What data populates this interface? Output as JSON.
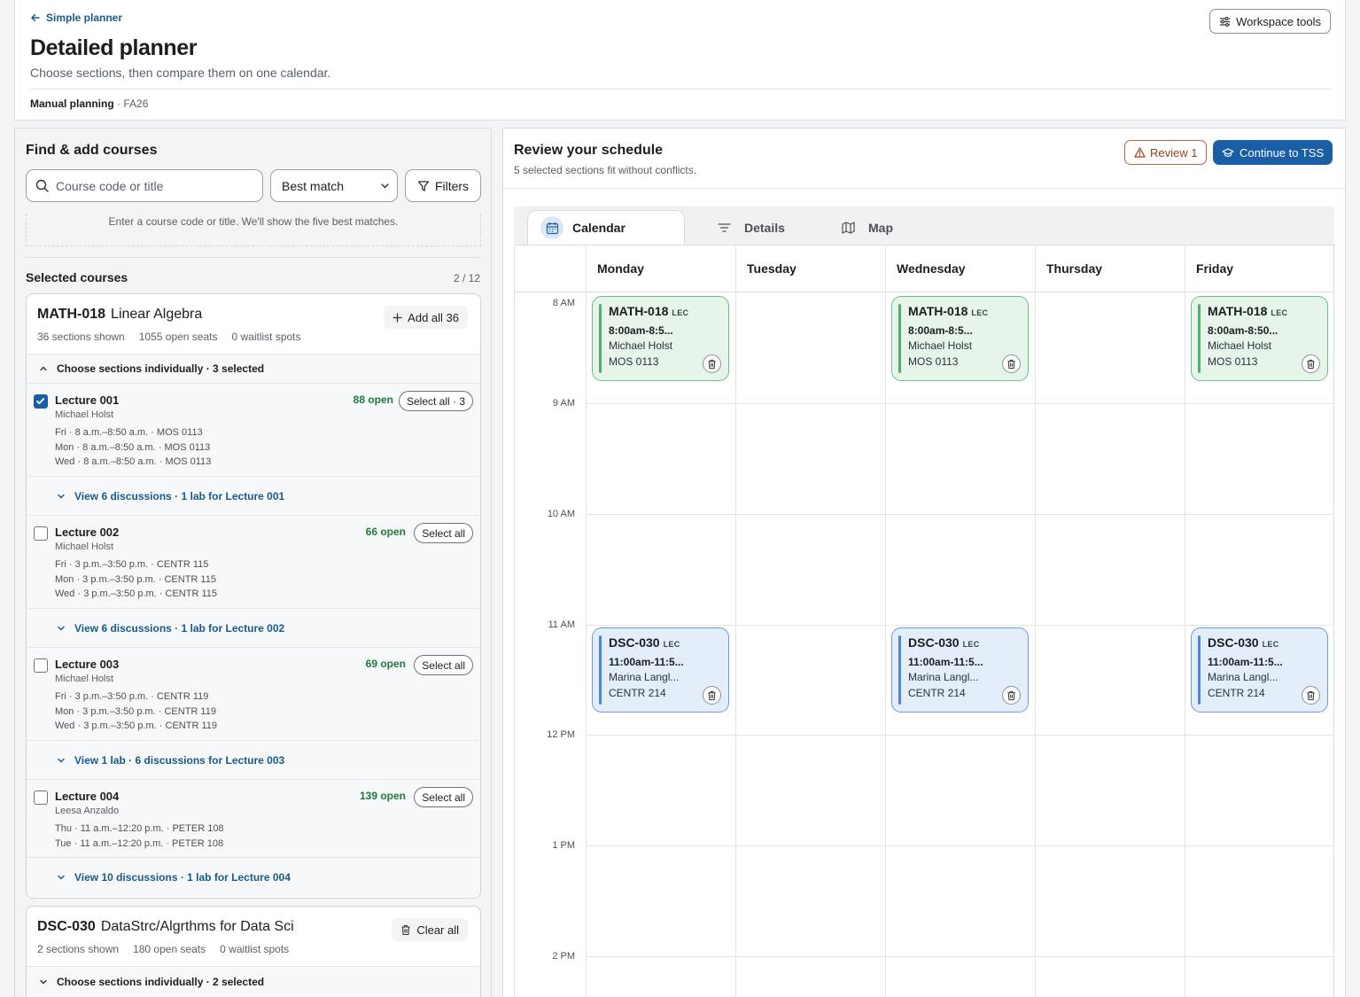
{
  "header": {
    "back_label": "Simple planner",
    "title": "Detailed planner",
    "subtitle": "Choose sections, then compare them on one calendar.",
    "plan_mode": "Manual planning",
    "term": "· FA26",
    "workspace_tools": "Workspace tools"
  },
  "finder": {
    "title": "Find & add courses",
    "search_placeholder": "Course code or title",
    "sort_value": "Best match",
    "filters_label": "Filters",
    "hint": "Enter a course code or title. We'll show the five best matches."
  },
  "selected": {
    "title": "Selected courses",
    "count": "2 / 12",
    "courses": [
      {
        "code": "MATH-018",
        "name": "Linear Algebra",
        "sections_shown": "36 sections shown",
        "open_seats": "1055 open seats",
        "waitlist": "0 waitlist spots",
        "action": "Add all 36",
        "toggle": "Choose sections individually · 3 selected",
        "lectures": [
          {
            "title": "Lecture 001",
            "prof": "Michael Holst",
            "open": "88 open",
            "select": "Select all · 3",
            "checked": true,
            "times": [
              "Fri · 8 a.m.–8:50 a.m. · MOS 0113",
              "Mon · 8 a.m.–8:50 a.m. · MOS 0113",
              "Wed · 8 a.m.–8:50 a.m. · MOS 0113"
            ],
            "discussions": "View 6 discussions · 1 lab for Lecture 001"
          },
          {
            "title": "Lecture 002",
            "prof": "Michael Holst",
            "open": "66 open",
            "select": "Select all",
            "checked": false,
            "times": [
              "Fri · 3 p.m.–3:50 p.m. · CENTR 115",
              "Mon · 3 p.m.–3:50 p.m. · CENTR 115",
              "Wed · 3 p.m.–3:50 p.m. · CENTR 115"
            ],
            "discussions": "View 6 discussions · 1 lab for Lecture 002"
          },
          {
            "title": "Lecture 003",
            "prof": "Michael Holst",
            "open": "69 open",
            "select": "Select all",
            "checked": false,
            "times": [
              "Fri · 3 p.m.–3:50 p.m. · CENTR 119",
              "Mon · 3 p.m.–3:50 p.m. · CENTR 119",
              "Wed · 3 p.m.–3:50 p.m. · CENTR 119"
            ],
            "discussions": "View 1 lab · 6 discussions for Lecture 003"
          },
          {
            "title": "Lecture 004",
            "prof": "Leesa Anzaldo",
            "open": "139 open",
            "select": "Select all",
            "checked": false,
            "times": [
              "Thu · 11 a.m.–12:20 p.m. · PETER 108",
              "Tue · 11 a.m.–12:20 p.m. · PETER 108"
            ],
            "discussions": "View 10 discussions · 1 lab for Lecture 004"
          }
        ]
      },
      {
        "code": "DSC-030",
        "name": "DataStrc/Algrthms for Data Sci",
        "sections_shown": "2 sections shown",
        "open_seats": "180 open seats",
        "waitlist": "0 waitlist spots",
        "action": "Clear all",
        "toggle": "Choose sections individually · 2 selected"
      }
    ]
  },
  "review": {
    "title": "Review your schedule",
    "subtitle": "5 selected sections fit without conflicts.",
    "review_label": "Review 1",
    "continue_label": "Continue to TSS",
    "tabs": [
      "Calendar",
      "Details",
      "Map"
    ],
    "days": [
      "Monday",
      "Tuesday",
      "Wednesday",
      "Thursday",
      "Friday"
    ],
    "times": [
      "8 AM",
      "9 AM",
      "10 AM",
      "11 AM",
      "12 PM",
      "1 PM",
      "2 PM"
    ],
    "events": {
      "math_mon": {
        "code": "MATH-018",
        "type": "LEC",
        "time": "8:00am-8:5...",
        "prof": "Michael Holst",
        "room": "MOS 0113"
      },
      "math_wed": {
        "code": "MATH-018",
        "type": "LEC",
        "time": "8:00am-8:5...",
        "prof": "Michael Holst",
        "room": "MOS 0113"
      },
      "math_fri": {
        "code": "MATH-018",
        "type": "LEC",
        "time": "8:00am-8:50...",
        "prof": "Michael Holst",
        "room": "MOS 0113"
      },
      "dsc_mon": {
        "code": "DSC-030",
        "type": "LEC",
        "time": "11:00am-11:5...",
        "prof": "Marina Langl...",
        "room": "CENTR 214"
      },
      "dsc_wed": {
        "code": "DSC-030",
        "type": "LEC",
        "time": "11:00am-11:5...",
        "prof": "Marina Langl...",
        "room": "CENTR 214"
      },
      "dsc_fri": {
        "code": "DSC-030",
        "type": "LEC",
        "time": "11:00am-11:5...",
        "prof": "Marina Langl...",
        "room": "CENTR 214"
      }
    }
  },
  "colors": {
    "accent": "#1a5fa6",
    "link": "#1a5a8a",
    "open": "#1e7a3e",
    "math_event": "#e6f4ea",
    "dsc_event": "#e4eefb"
  }
}
